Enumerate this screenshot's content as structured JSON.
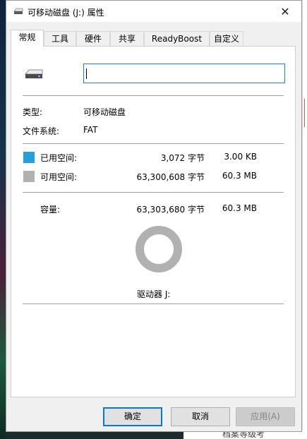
{
  "window": {
    "title": "可移动磁盘 (J:) 属性",
    "close_glyph": "✕"
  },
  "tabs": [
    {
      "label": "常规",
      "active": true
    },
    {
      "label": "工具"
    },
    {
      "label": "硬件"
    },
    {
      "label": "共享"
    },
    {
      "label": "ReadyBoost"
    },
    {
      "label": "自定义"
    }
  ],
  "general": {
    "name_value": "",
    "type_label": "类型:",
    "type_value": "可移动磁盘",
    "fs_label": "文件系统:",
    "fs_value": "FAT",
    "used": {
      "label": "已用空间:",
      "bytes": "3,072 字节",
      "size": "3.00 KB",
      "color": "#26a0da"
    },
    "free": {
      "label": "可用空间:",
      "bytes": "63,300,608 字节",
      "size": "60.3 MB",
      "color": "#b1b1b1"
    },
    "capacity": {
      "label": "容量:",
      "bytes": "63,303,680 字节",
      "size": "60.3 MB"
    },
    "drive_label": "驱动器 J:"
  },
  "buttons": {
    "ok": "确定",
    "cancel": "取消",
    "apply": "应用(A)"
  },
  "background": {
    "bottom_text": "档案等级考"
  }
}
